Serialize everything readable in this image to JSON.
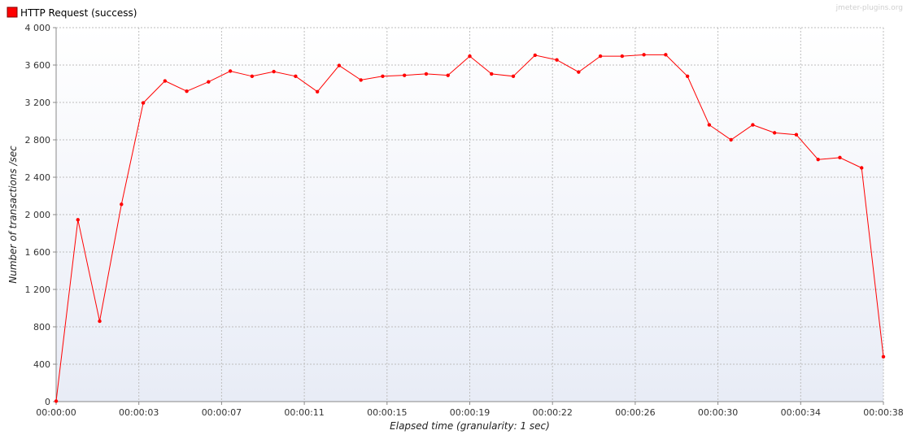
{
  "watermark": "jmeter-plugins.org",
  "colors": {
    "series": "#ff0000",
    "background_top": "#ffffff",
    "background_bottom": "#e8ecf6"
  },
  "chart_data": {
    "type": "line",
    "xlabel": "Elapsed time (granularity: 1 sec)",
    "ylabel": "Number of transactions /sec",
    "xlim": [
      0,
      38
    ],
    "ylim": [
      0,
      4000
    ],
    "x_tick_values": [
      0,
      3.8,
      7.6,
      11.4,
      15.2,
      19,
      22.8,
      26.6,
      30.4,
      34.2,
      38
    ],
    "x_tick_labels": [
      "00:00:00",
      "00:00:03",
      "00:00:07",
      "00:00:11",
      "00:00:15",
      "00:00:19",
      "00:00:22",
      "00:00:26",
      "00:00:30",
      "00:00:34",
      "00:00:38"
    ],
    "y_tick_values": [
      0,
      400,
      800,
      1200,
      1600,
      2000,
      2400,
      2800,
      3200,
      3600,
      4000
    ],
    "y_tick_labels": [
      "0",
      "400",
      "800",
      "1 200",
      "1 600",
      "2 000",
      "2 400",
      "2 800",
      "3 200",
      "3 600",
      "4 000"
    ],
    "grid": true,
    "legend_position": "top-left",
    "series": [
      {
        "name": "HTTP Request (success)",
        "color": "#ff0000",
        "x": [
          0,
          1,
          2,
          3,
          4,
          5,
          6,
          7,
          8,
          9,
          10,
          11,
          12,
          13,
          14,
          15,
          16,
          17,
          18,
          19,
          20,
          21,
          22,
          23,
          24,
          25,
          26,
          27,
          28,
          29,
          30,
          31,
          32,
          33,
          34,
          35,
          36,
          37,
          38
        ],
        "y": [
          5,
          1945,
          860,
          2110,
          3195,
          3430,
          3320,
          3420,
          3535,
          3480,
          3530,
          3480,
          3315,
          3595,
          3440,
          3480,
          3490,
          3505,
          3490,
          3695,
          3505,
          3480,
          3705,
          3655,
          3525,
          3695,
          3695,
          3710,
          3710,
          3480,
          2960,
          2800,
          2960,
          2875,
          2855,
          2590,
          2610,
          2500,
          480
        ]
      }
    ]
  }
}
